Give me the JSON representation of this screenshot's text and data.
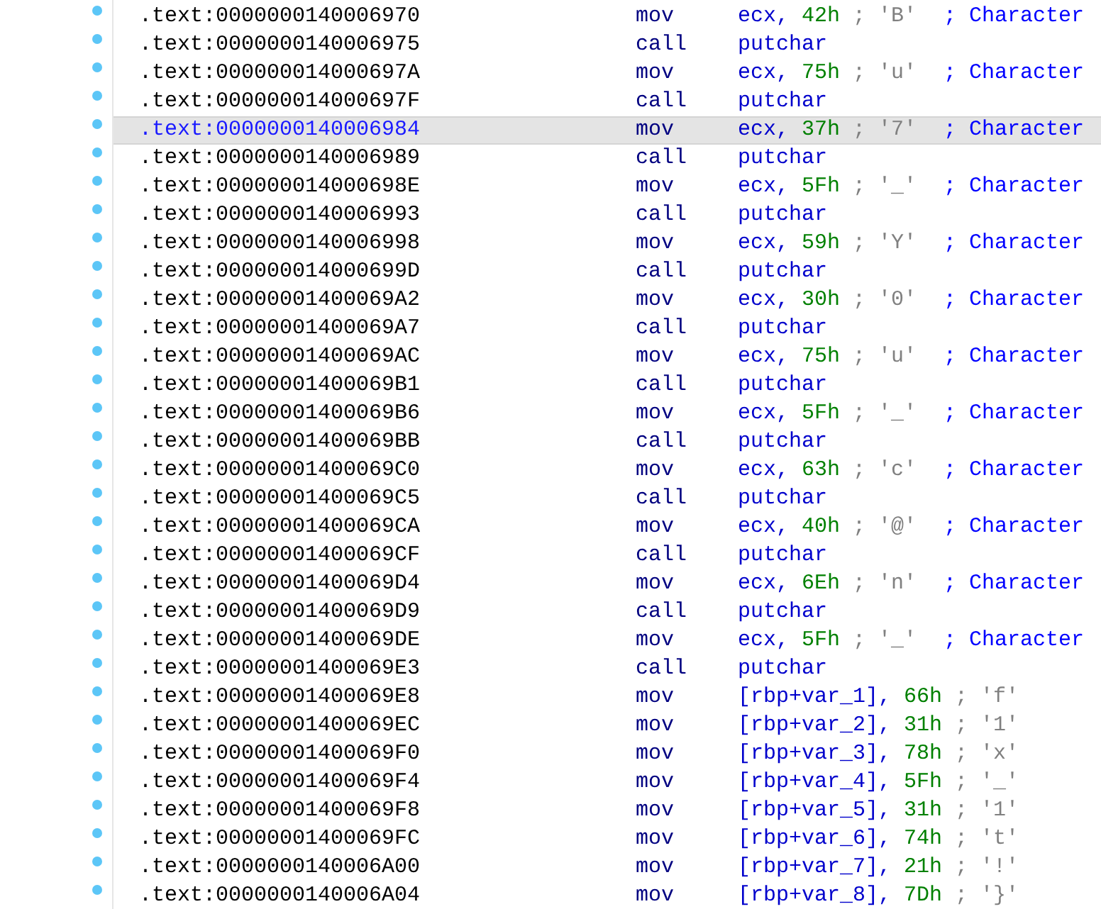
{
  "rows": [
    {
      "address": ".text:0000000140006970",
      "mnemonic": "mov",
      "operand": "ecx,",
      "value": "42h",
      "comment": "; 'B'",
      "note": "; Character",
      "selected": false
    },
    {
      "address": ".text:0000000140006975",
      "mnemonic": "call",
      "operand": "putchar",
      "selected": false
    },
    {
      "address": ".text:000000014000697A",
      "mnemonic": "mov",
      "operand": "ecx,",
      "value": "75h",
      "comment": "; 'u'",
      "note": "; Character",
      "selected": false
    },
    {
      "address": ".text:000000014000697F",
      "mnemonic": "call",
      "operand": "putchar",
      "selected": false
    },
    {
      "address": ".text:0000000140006984",
      "mnemonic": "mov",
      "operand": "ecx,",
      "value": "37h",
      "comment": "; '7'",
      "note": "; Character",
      "selected": true
    },
    {
      "address": ".text:0000000140006989",
      "mnemonic": "call",
      "operand": "putchar",
      "selected": false
    },
    {
      "address": ".text:000000014000698E",
      "mnemonic": "mov",
      "operand": "ecx,",
      "value": "5Fh",
      "comment": "; '_'",
      "note": "; Character",
      "selected": false
    },
    {
      "address": ".text:0000000140006993",
      "mnemonic": "call",
      "operand": "putchar",
      "selected": false
    },
    {
      "address": ".text:0000000140006998",
      "mnemonic": "mov",
      "operand": "ecx,",
      "value": "59h",
      "comment": "; 'Y'",
      "note": "; Character",
      "selected": false
    },
    {
      "address": ".text:000000014000699D",
      "mnemonic": "call",
      "operand": "putchar",
      "selected": false
    },
    {
      "address": ".text:00000001400069A2",
      "mnemonic": "mov",
      "operand": "ecx,",
      "value": "30h",
      "comment": "; '0'",
      "note": "; Character",
      "selected": false
    },
    {
      "address": ".text:00000001400069A7",
      "mnemonic": "call",
      "operand": "putchar",
      "selected": false
    },
    {
      "address": ".text:00000001400069AC",
      "mnemonic": "mov",
      "operand": "ecx,",
      "value": "75h",
      "comment": "; 'u'",
      "note": "; Character",
      "selected": false
    },
    {
      "address": ".text:00000001400069B1",
      "mnemonic": "call",
      "operand": "putchar",
      "selected": false
    },
    {
      "address": ".text:00000001400069B6",
      "mnemonic": "mov",
      "operand": "ecx,",
      "value": "5Fh",
      "comment": "; '_'",
      "note": "; Character",
      "selected": false
    },
    {
      "address": ".text:00000001400069BB",
      "mnemonic": "call",
      "operand": "putchar",
      "selected": false
    },
    {
      "address": ".text:00000001400069C0",
      "mnemonic": "mov",
      "operand": "ecx,",
      "value": "63h",
      "comment": "; 'c'",
      "note": "; Character",
      "selected": false
    },
    {
      "address": ".text:00000001400069C5",
      "mnemonic": "call",
      "operand": "putchar",
      "selected": false
    },
    {
      "address": ".text:00000001400069CA",
      "mnemonic": "mov",
      "operand": "ecx,",
      "value": "40h",
      "comment": "; '@'",
      "note": "; Character",
      "selected": false
    },
    {
      "address": ".text:00000001400069CF",
      "mnemonic": "call",
      "operand": "putchar",
      "selected": false
    },
    {
      "address": ".text:00000001400069D4",
      "mnemonic": "mov",
      "operand": "ecx,",
      "value": "6Eh",
      "comment": "; 'n'",
      "note": "; Character",
      "selected": false
    },
    {
      "address": ".text:00000001400069D9",
      "mnemonic": "call",
      "operand": "putchar",
      "selected": false
    },
    {
      "address": ".text:00000001400069DE",
      "mnemonic": "mov",
      "operand": "ecx,",
      "value": "5Fh",
      "comment": "; '_'",
      "note": "; Character",
      "selected": false
    },
    {
      "address": ".text:00000001400069E3",
      "mnemonic": "call",
      "operand": "putchar",
      "selected": false
    },
    {
      "address": ".text:00000001400069E8",
      "mnemonic": "mov",
      "operand": "[rbp+var_1],",
      "value": "66h",
      "comment": "; 'f'",
      "selected": false
    },
    {
      "address": ".text:00000001400069EC",
      "mnemonic": "mov",
      "operand": "[rbp+var_2],",
      "value": "31h",
      "comment": "; '1'",
      "selected": false
    },
    {
      "address": ".text:00000001400069F0",
      "mnemonic": "mov",
      "operand": "[rbp+var_3],",
      "value": "78h",
      "comment": "; 'x'",
      "selected": false
    },
    {
      "address": ".text:00000001400069F4",
      "mnemonic": "mov",
      "operand": "[rbp+var_4],",
      "value": "5Fh",
      "comment": "; '_'",
      "selected": false
    },
    {
      "address": ".text:00000001400069F8",
      "mnemonic": "mov",
      "operand": "[rbp+var_5],",
      "value": "31h",
      "comment": "; '1'",
      "selected": false
    },
    {
      "address": ".text:00000001400069FC",
      "mnemonic": "mov",
      "operand": "[rbp+var_6],",
      "value": "74h",
      "comment": "; 't'",
      "selected": false
    },
    {
      "address": ".text:0000000140006A00",
      "mnemonic": "mov",
      "operand": "[rbp+var_7],",
      "value": "21h",
      "comment": "; '!'",
      "selected": false
    },
    {
      "address": ".text:0000000140006A04",
      "mnemonic": "mov",
      "operand": "[rbp+var_8],",
      "value": "7Dh",
      "comment": "; '}'",
      "selected": false
    }
  ]
}
